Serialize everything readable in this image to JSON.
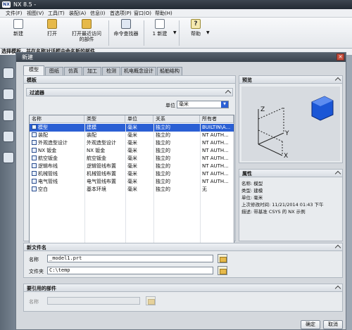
{
  "app": {
    "title": "NX 8.5 -"
  },
  "menu": [
    "文件(F)",
    "视图(V)",
    "工具(T)",
    "装配(A)",
    "信息(I)",
    "首选项(P)",
    "窗口(O)",
    "帮助(H)"
  ],
  "toolbar": {
    "new_label": "新建",
    "open_label": "打开",
    "open_recent_label_1": "打开最近访问",
    "open_recent_label_2": "的部件",
    "command_finder_label": "命令查找器",
    "window_label": "1 新建",
    "help_label": "帮助"
  },
  "status_hint": "选择模板，并在名称对话框中命名新的部件",
  "dialog": {
    "title": "新建",
    "tabs": [
      "模型",
      "图纸",
      "仿真",
      "加工",
      "检测",
      "机电概念设计",
      "船舶结构"
    ],
    "templates_section": "模板",
    "filter_section": "过滤器",
    "unit_label": "单位",
    "unit_value": "毫米",
    "columns": [
      "名称",
      "类型",
      "单位",
      "关系",
      "所有者"
    ],
    "rows": [
      {
        "name": "模型",
        "type": "建模",
        "unit": "毫米",
        "relation": "独立的",
        "owner": "BUILTIN\\A..."
      },
      {
        "name": "装配",
        "type": "装配",
        "unit": "毫米",
        "relation": "独立的",
        "owner": "NT AUTH..."
      },
      {
        "name": "外观造型设计",
        "type": "外观造型设计",
        "unit": "毫米",
        "relation": "独立的",
        "owner": "NT AUTH..."
      },
      {
        "name": "NX 钣金",
        "type": "NX 钣金",
        "unit": "毫米",
        "relation": "独立的",
        "owner": "NT AUTH..."
      },
      {
        "name": "航空钣金",
        "type": "航空钣金",
        "unit": "毫米",
        "relation": "独立的",
        "owner": "NT AUTH..."
      },
      {
        "name": "逻辑布线",
        "type": "逻辑管线布置",
        "unit": "毫米",
        "relation": "独立的",
        "owner": "NT AUTH..."
      },
      {
        "name": "机械管线",
        "type": "机械管线布置",
        "unit": "毫米",
        "relation": "独立的",
        "owner": "NT AUTH..."
      },
      {
        "name": "电气管线",
        "type": "电气管线布置",
        "unit": "毫米",
        "relation": "独立的",
        "owner": "NT AUTH..."
      },
      {
        "name": "空白",
        "type": "基本环境",
        "unit": "毫米",
        "relation": "独立的",
        "owner": "无"
      }
    ],
    "preview_section": "预览",
    "preview_axes": {
      "z": "Z",
      "y": "Y",
      "x": "X"
    },
    "properties_section": "属性",
    "properties": [
      {
        "label": "名称:",
        "value": "模型"
      },
      {
        "label": "类型:",
        "value": "建模"
      },
      {
        "label": "单位:",
        "value": "毫米"
      },
      {
        "label": "上次修改时间:",
        "value": "11/21/2014 01:43 下午"
      },
      {
        "label": "描述:",
        "value": "带基准 CSYS 的 NX 示例"
      }
    ],
    "new_file_section": "新文件名",
    "name_label": "名称",
    "name_value": "_model1.prt",
    "folder_label": "文件夹",
    "folder_value": "C:\\temp",
    "ref_section": "要引用的部件",
    "ref_name_label": "名称",
    "ok_label": "确定",
    "cancel_label": "取消"
  }
}
